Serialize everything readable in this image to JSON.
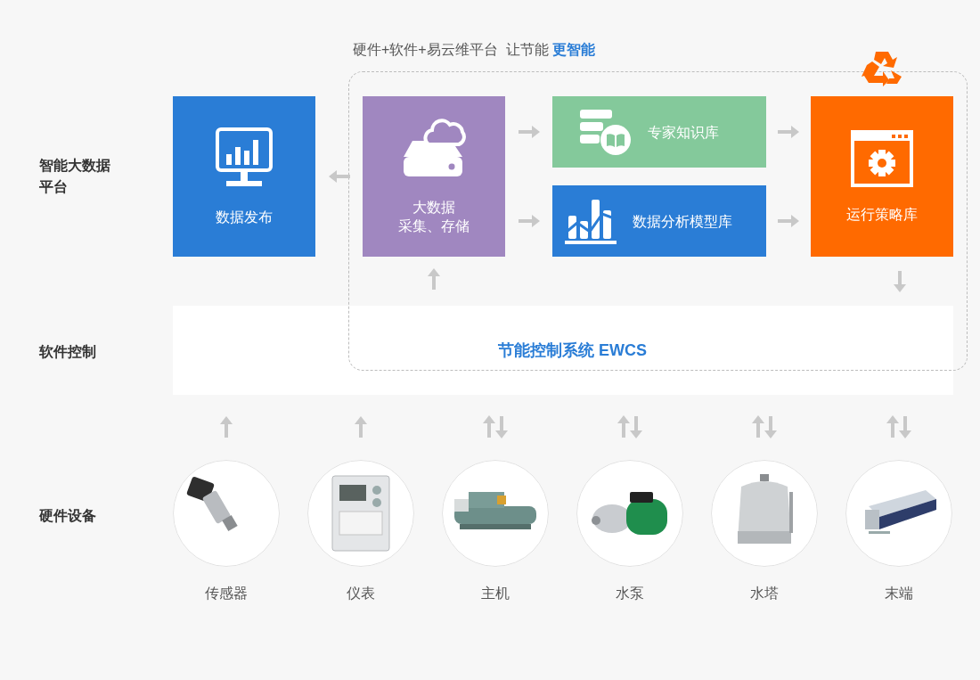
{
  "headline": "硬件+软件+易云维平台  让节能 **更智能**",
  "row_labels": [
    {
      "text": "智能大数据平台"
    },
    {
      "text": "软件控制"
    },
    {
      "text": "硬件设备"
    }
  ],
  "modules": [
    {
      "kind": "publish",
      "lines": [
        "数据发布"
      ],
      "color": "#2a7dd6"
    },
    {
      "kind": "collect",
      "lines": [
        "大数据",
        "采集、存储"
      ],
      "color": "#a087c0"
    },
    {
      "kind": "knowledge",
      "lines": [
        "专家知识库"
      ],
      "color": "#84c99b"
    },
    {
      "kind": "analysis",
      "lines": [
        "数据分析模型库"
      ],
      "color": "#2a7dd6"
    },
    {
      "kind": "strategy",
      "lines": [
        "运行策略库"
      ],
      "color": "#ff6a00"
    }
  ],
  "control_system": {
    "name": "节能控制系统 EWCS"
  },
  "devices": [
    {
      "name": "传感器",
      "two_way": false,
      "kind": "sensor"
    },
    {
      "name": "仪表",
      "two_way": false,
      "kind": "meter"
    },
    {
      "name": "主机",
      "two_way": true,
      "kind": "chiller"
    },
    {
      "name": "水泵",
      "two_way": true,
      "kind": "pump"
    },
    {
      "name": "水塔",
      "two_way": true,
      "kind": "tower"
    },
    {
      "name": "末端",
      "two_way": true,
      "kind": "coil"
    }
  ]
}
